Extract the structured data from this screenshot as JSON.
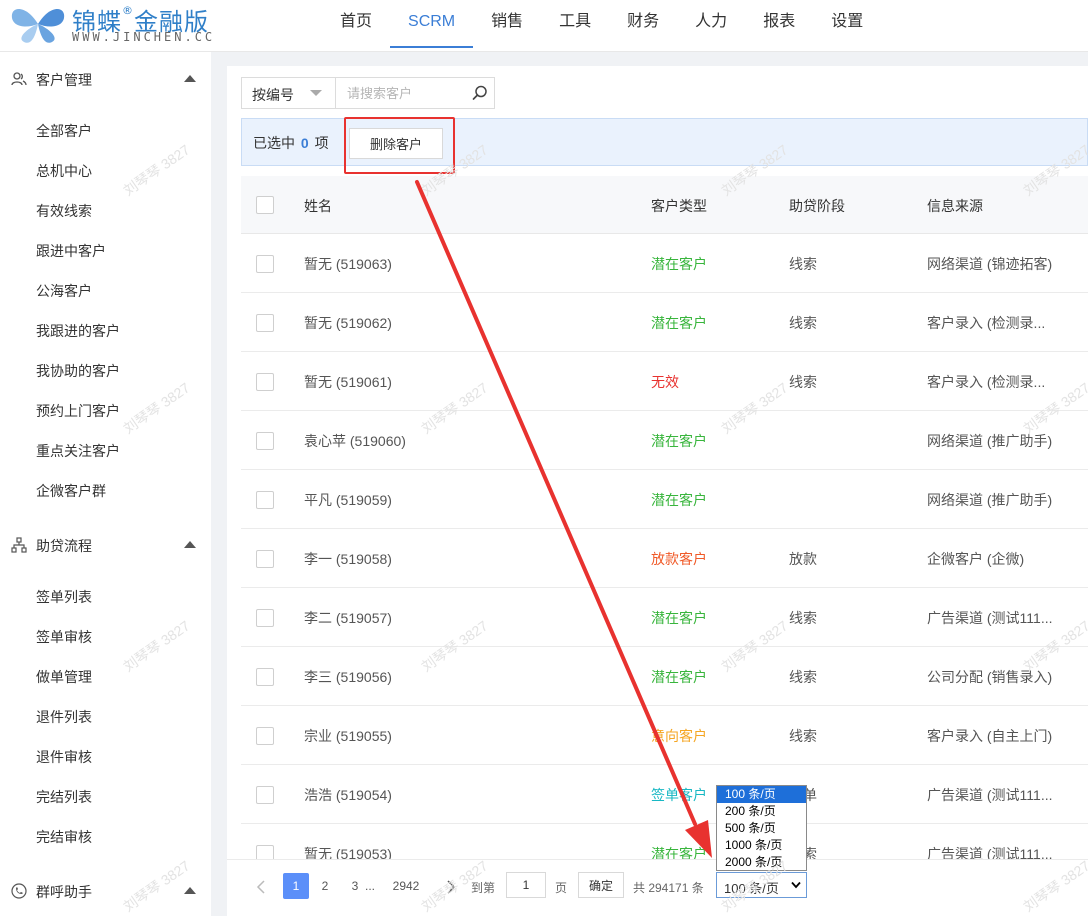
{
  "brand": {
    "name": "锦蝶",
    "reg": "®",
    "edition": "金融版",
    "url": "WWW.JINCHEN.CC"
  },
  "nav": {
    "items": [
      {
        "label": "首页",
        "active": false
      },
      {
        "label": "SCRM",
        "active": true
      },
      {
        "label": "销售",
        "active": false
      },
      {
        "label": "工具",
        "active": false
      },
      {
        "label": "财务",
        "active": false
      },
      {
        "label": "人力",
        "active": false
      },
      {
        "label": "报表",
        "active": false
      },
      {
        "label": "设置",
        "active": false
      }
    ]
  },
  "sidebar": {
    "groups": [
      {
        "label": "客户管理",
        "icon": "users-icon",
        "expanded": true
      },
      {
        "label": "助贷流程",
        "icon": "hierarchy-icon",
        "expanded": true
      },
      {
        "label": "群呼助手",
        "icon": "phone-icon",
        "expanded": true
      }
    ],
    "customer_items": [
      "全部客户",
      "总机中心",
      "有效线索",
      "跟进中客户",
      "公海客户",
      "我跟进的客户",
      "我协助的客户",
      "预约上门客户",
      "重点关注客户",
      "企微客户群"
    ],
    "loan_items": [
      "签单列表",
      "签单审核",
      "做单管理",
      "退件列表",
      "退件审核",
      "完结列表",
      "完结审核"
    ]
  },
  "search": {
    "field_label": "按编号",
    "placeholder": "请搜索客户"
  },
  "selection": {
    "prefix": "已选中",
    "count": "0",
    "suffix": "项",
    "delete_label": "删除客户"
  },
  "table": {
    "headers": [
      "姓名",
      "客户类型",
      "助贷阶段",
      "信息来源"
    ],
    "rows": [
      {
        "name": "暂无 (519063)",
        "type": "潜在客户",
        "type_color": "#38b53c",
        "stage": "线索",
        "source": "网络渠道 (锦迹拓客)"
      },
      {
        "name": "暂无 (519062)",
        "type": "潜在客户",
        "type_color": "#38b53c",
        "stage": "线索",
        "source": "客户录入 (检测录..."
      },
      {
        "name": "暂无 (519061)",
        "type": "无效",
        "type_color": "#e8322f",
        "stage": "线索",
        "source": "客户录入 (检测录..."
      },
      {
        "name": "袁心苹 (519060)",
        "type": "潜在客户",
        "type_color": "#38b53c",
        "stage": "",
        "source": "网络渠道 (推广助手)"
      },
      {
        "name": "平凡 (519059)",
        "type": "潜在客户",
        "type_color": "#38b53c",
        "stage": "",
        "source": "网络渠道 (推广助手)"
      },
      {
        "name": "李一 (519058)",
        "type": "放款客户",
        "type_color": "#f05a28",
        "stage": "放款",
        "source": "企微客户 (企微)"
      },
      {
        "name": "李二 (519057)",
        "type": "潜在客户",
        "type_color": "#38b53c",
        "stage": "线索",
        "source": "广告渠道 (测试111..."
      },
      {
        "name": "李三 (519056)",
        "type": "潜在客户",
        "type_color": "#38b53c",
        "stage": "线索",
        "source": "公司分配 (销售录入)"
      },
      {
        "name": "宗业 (519055)",
        "type": "意向客户",
        "type_color": "#f5a623",
        "stage": "线索",
        "source": "客户录入 (自主上门)"
      },
      {
        "name": "浩浩 (519054)",
        "type": "签单客户",
        "type_color": "#18b8c4",
        "stage": "签单",
        "source": "广告渠道 (测试111..."
      },
      {
        "name": "暂无 (519053)",
        "type": "潜在客户",
        "type_color": "#38b53c",
        "stage": "线索",
        "source": "广告渠道 (测试111..."
      }
    ]
  },
  "pagination": {
    "pages": [
      "1",
      "2",
      "3",
      "...",
      "2942"
    ],
    "current": "1",
    "goto_prefix": "到第",
    "goto_value": "1",
    "goto_suffix": "页",
    "confirm_label": "确定",
    "total_text": "共 294171 条",
    "page_size": "100 条/页",
    "page_size_options": [
      "100 条/页",
      "200 条/页",
      "500 条/页",
      "1000 条/页",
      "2000 条/页"
    ]
  },
  "watermark": "刘琴琴 3827",
  "colors": {
    "accent": "#3b7ed6",
    "annotation": "#e8322f"
  }
}
